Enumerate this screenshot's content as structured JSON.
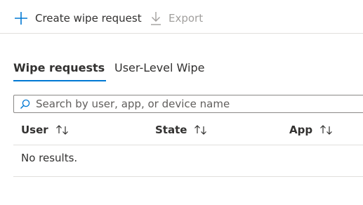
{
  "toolbar": {
    "create_label": "Create wipe request",
    "create_icon": "add-icon",
    "export_label": "Export",
    "export_icon": "download-icon",
    "export_enabled": false
  },
  "tabs": [
    {
      "label": "Wipe requests",
      "active": true
    },
    {
      "label": "User-Level Wipe",
      "active": false
    }
  ],
  "search": {
    "placeholder": "Search by user, app, or device name",
    "value": ""
  },
  "table": {
    "columns": [
      {
        "label": "User",
        "sortable": true
      },
      {
        "label": "State",
        "sortable": true
      },
      {
        "label": "App",
        "sortable": true
      }
    ],
    "rows": [],
    "empty_text": "No results."
  },
  "colors": {
    "accent": "#0078d4",
    "text": "#323130",
    "disabled_text": "#a19f9d",
    "divider": "#e1dfdd"
  }
}
